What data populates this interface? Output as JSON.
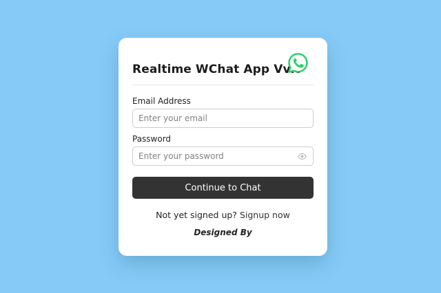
{
  "colors": {
    "background": "#86cbf7",
    "card": "#ffffff",
    "button": "#333333",
    "whatsapp_green": "#25d366"
  },
  "header": {
    "title": "Realtime WChat App Vvit",
    "icon": "whatsapp-icon"
  },
  "form": {
    "email_label": "Email Address",
    "email_placeholder": "Enter your email",
    "email_value": "",
    "password_label": "Password",
    "password_placeholder": "Enter your password",
    "password_value": "",
    "password_toggle_icon": "eye-icon",
    "submit_label": "Continue to Chat"
  },
  "footer": {
    "signup_prompt": "Not yet signed up?",
    "signup_link": "Signup now",
    "designed_by": "Designed By"
  }
}
